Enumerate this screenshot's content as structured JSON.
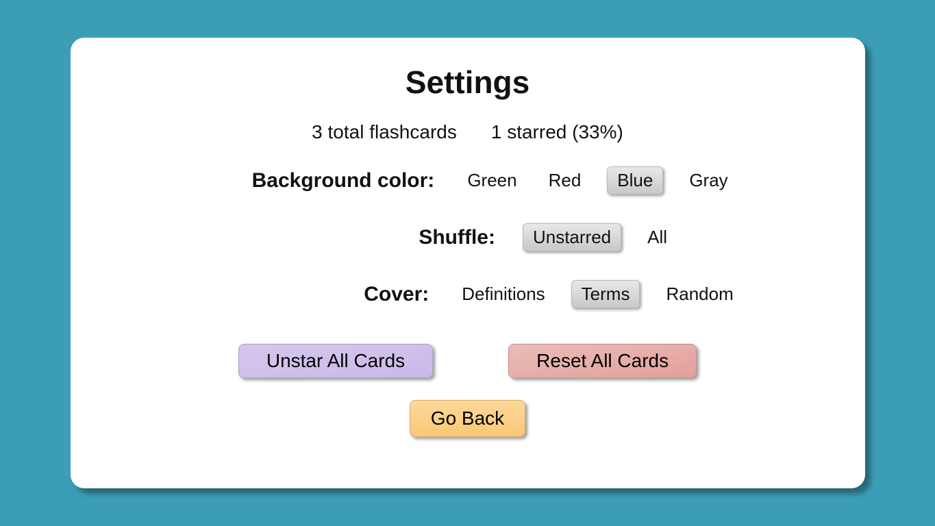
{
  "title": "Settings",
  "stats": {
    "total": "3 total flashcards",
    "starred": "1 starred (33%)"
  },
  "settings": {
    "background": {
      "label": "Background color:",
      "options": [
        "Green",
        "Red",
        "Blue",
        "Gray"
      ],
      "selected": "Blue"
    },
    "shuffle": {
      "label": "Shuffle:",
      "options": [
        "Unstarred",
        "All"
      ],
      "selected": "Unstarred"
    },
    "cover": {
      "label": "Cover:",
      "options": [
        "Definitions",
        "Terms",
        "Random"
      ],
      "selected": "Terms"
    }
  },
  "actions": {
    "unstar": "Unstar All Cards",
    "reset": "Reset All Cards",
    "goback": "Go Back"
  }
}
